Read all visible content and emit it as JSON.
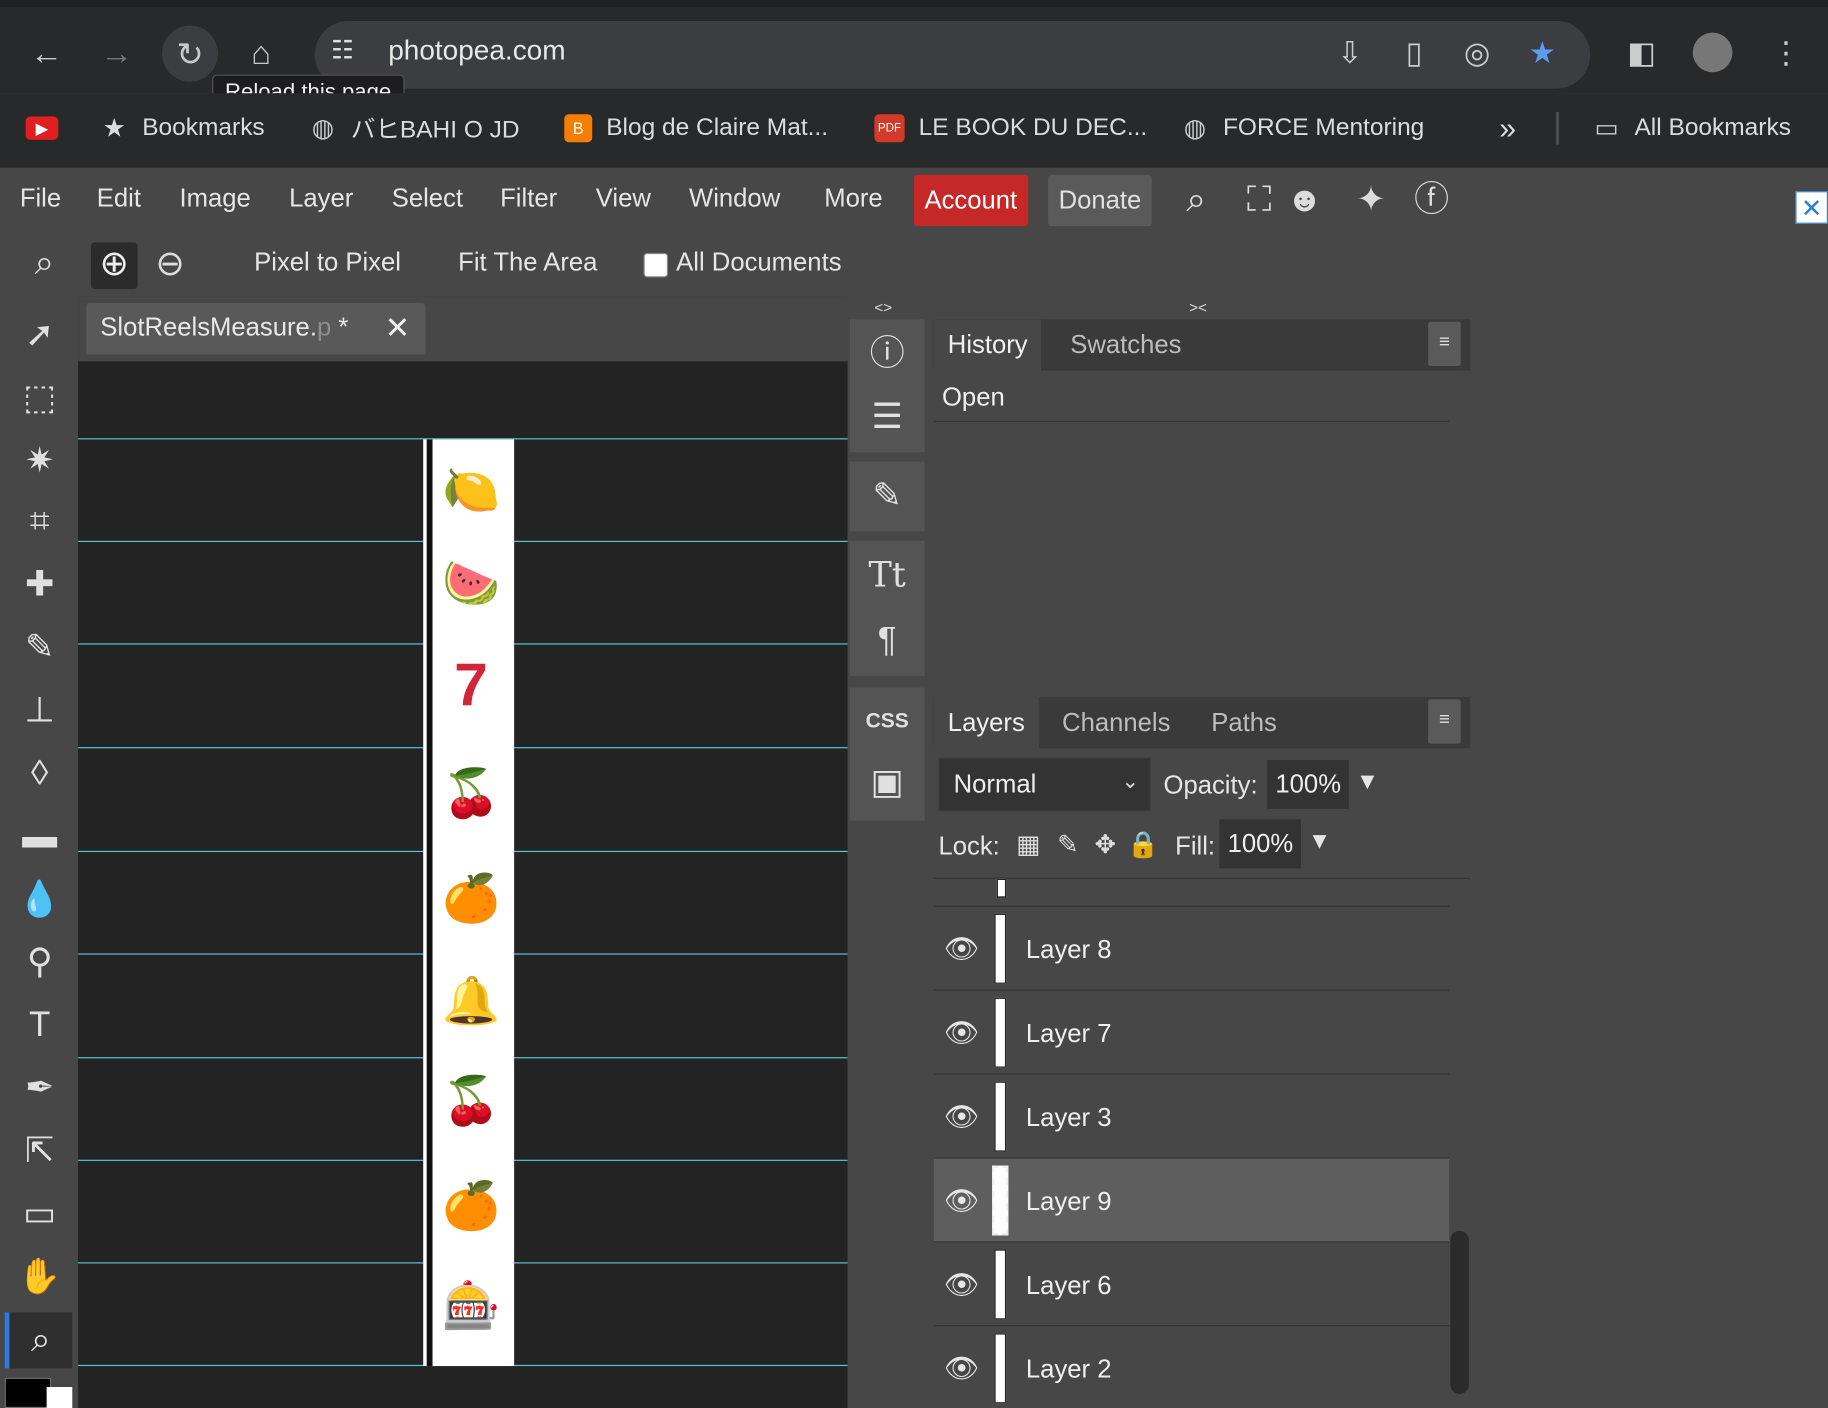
{
  "browser": {
    "url": "photopea.com",
    "tooltip": "Reload this page",
    "nav": {
      "back": "←",
      "forward": "→",
      "reload": "↻",
      "home": "⌂"
    },
    "omnibox_icons": [
      "install-icon",
      "document-icon",
      "eye-slash-icon",
      "star-icon"
    ],
    "bookmarks": [
      {
        "label": "Bookmarks",
        "icon": "star-icon"
      },
      {
        "label": "バヒBAHI O JD",
        "icon": "globe-icon"
      },
      {
        "label": "Blog de Claire Mat...",
        "icon": "blogger-icon"
      },
      {
        "label": "LE BOOK DU DEC...",
        "icon": "pdf-icon"
      },
      {
        "label": "FORCE Mentoring",
        "icon": "globe-icon"
      }
    ],
    "all_bookmarks": "All Bookmarks",
    "more_bookmarks": "»",
    "bm_icon_text": {
      "youtube": "▶",
      "pdf": "PDF",
      "blogger": "B"
    },
    "colors": {
      "chrome": "#28292b",
      "star": "#5b9bf0"
    }
  },
  "menu": {
    "items": [
      "File",
      "Edit",
      "Image",
      "Layer",
      "Select",
      "Filter",
      "View",
      "Window",
      "More"
    ],
    "account": "Account",
    "donate": "Donate",
    "ad_close": "✕"
  },
  "options": {
    "pixel_to_pixel": "Pixel to Pixel",
    "fit_area": "Fit The Area",
    "all_documents": "All Documents",
    "zoom_in": "⊕",
    "zoom_out": "⊖"
  },
  "document": {
    "name": "SlotReelsMeasure.",
    "name_suffix": "p",
    "modified": " *",
    "close": "✕",
    "symbols": [
      "🍋",
      "🍉",
      "7",
      "🍒",
      "🍊",
      "🔔",
      "🍒",
      "🍊",
      "🎰"
    ],
    "guide_color": "#5cc7d8"
  },
  "history": {
    "tabs": [
      "History",
      "Swatches"
    ],
    "items": [
      "Open"
    ]
  },
  "layers": {
    "tabs": [
      "Layers",
      "Channels",
      "Paths"
    ],
    "blend_mode": "Normal",
    "opacity_label": "Opacity:",
    "opacity": "100%",
    "lock_label": "Lock:",
    "fill_label": "Fill:",
    "fill": "100%",
    "items": [
      {
        "name": "Layer 8",
        "visible": true,
        "selected": false
      },
      {
        "name": "Layer 7",
        "visible": true,
        "selected": false
      },
      {
        "name": "Layer 3",
        "visible": true,
        "selected": false
      },
      {
        "name": "Layer 9",
        "visible": true,
        "selected": true
      },
      {
        "name": "Layer 6",
        "visible": true,
        "selected": false
      },
      {
        "name": "Layer 2",
        "visible": true,
        "selected": false
      }
    ]
  },
  "panel_toggles": {
    "left": "<>",
    "right": "><"
  },
  "icon_panel": {
    "css_label": "CSS"
  }
}
